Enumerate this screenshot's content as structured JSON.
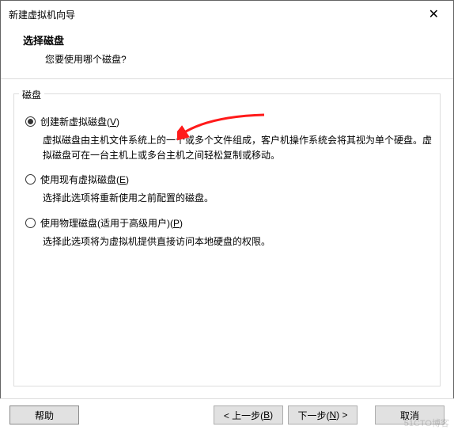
{
  "window": {
    "title": "新建虚拟机向导"
  },
  "header": {
    "step_title": "选择磁盘",
    "step_sub": "您要使用哪个磁盘?"
  },
  "group": {
    "label": "磁盘"
  },
  "options": [
    {
      "label_pre": "创建新虚拟磁盘(",
      "mnemonic": "V",
      "label_post": ")",
      "desc": "虚拟磁盘由主机文件系统上的一个或多个文件组成，客户机操作系统会将其视为单个硬盘。虚拟磁盘可在一台主机上或多台主机之间轻松复制或移动。",
      "checked": true
    },
    {
      "label_pre": "使用现有虚拟磁盘(",
      "mnemonic": "E",
      "label_post": ")",
      "desc": "选择此选项将重新使用之前配置的磁盘。",
      "checked": false
    },
    {
      "label_pre": "使用物理磁盘(适用于高级用户)(",
      "mnemonic": "P",
      "label_post": ")",
      "desc": "选择此选项将为虚拟机提供直接访问本地硬盘的权限。",
      "checked": false
    }
  ],
  "buttons": {
    "help": "帮助",
    "back_pre": "< 上一步(",
    "back_m": "B",
    "back_post": ")",
    "next_pre": "下一步(",
    "next_m": "N",
    "next_post": ") >",
    "cancel": "取消"
  },
  "watermark": "51CTO博客"
}
